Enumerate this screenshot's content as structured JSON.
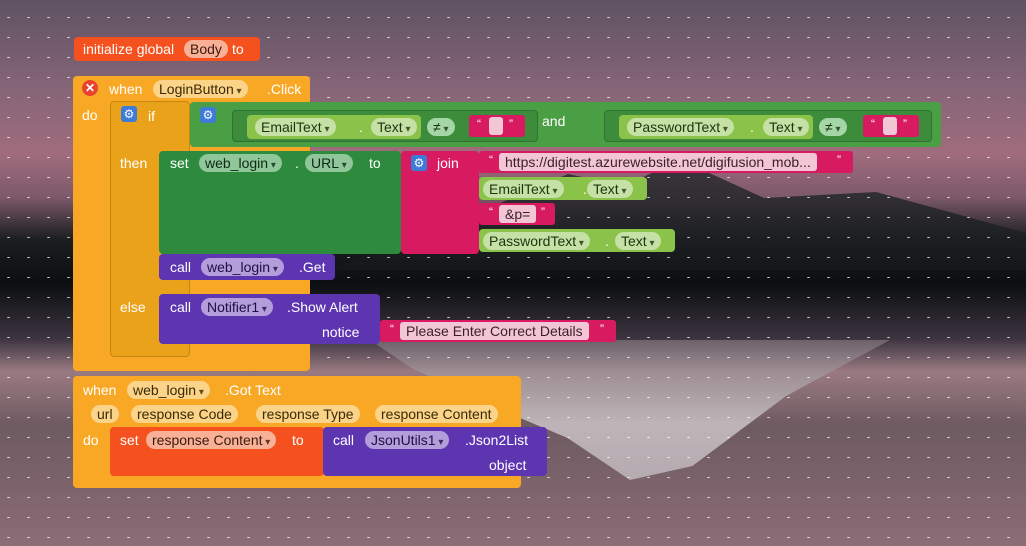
{
  "global": {
    "init_label": "initialize global",
    "var_name": "Body",
    "to_label": "to"
  },
  "login_click": {
    "when": "when",
    "component": "LoginButton",
    "event": ".Click",
    "do": "do",
    "if": "if",
    "then": "then",
    "else": "else",
    "and": "and",
    "email_comp": "EmailText",
    "email_prop": "Text",
    "password_comp": "PasswordText",
    "password_prop": "Text",
    "neq": "≠",
    "set_label": "set",
    "set_comp": "web_login",
    "set_prop": "URL",
    "set_to": "to",
    "join": "join",
    "url_text": "https://digitest.azurewebsite.net/digifusion_mob...",
    "amp_text": "&p=",
    "call_label": "call",
    "call_comp": "web_login",
    "call_method": ".Get",
    "notifier_comp": "Notifier1",
    "notifier_method": ".Show Alert",
    "notice_label": "notice",
    "notice_text": "Please Enter Correct Details"
  },
  "got_text": {
    "when": "when",
    "component": "web_login",
    "event": ".Got Text",
    "params": [
      "url",
      "response Code",
      "response Type",
      "response Content"
    ],
    "do": "do",
    "set_label": "set",
    "set_var": "response Content",
    "to_label": "to",
    "call_label": "call",
    "call_comp": "JsonUtils1",
    "call_method": ".Json2List",
    "object_label": "object"
  },
  "colors": {
    "event": "#f9a825",
    "control": "#eaa21a",
    "logic": "#4a9e43",
    "compare": "#3c8c3c",
    "getter": "#8bc34a",
    "setter": "#2e8b3e",
    "text": "#d81b60",
    "procedure": "#5e35b1",
    "variable": "#f4511e"
  }
}
